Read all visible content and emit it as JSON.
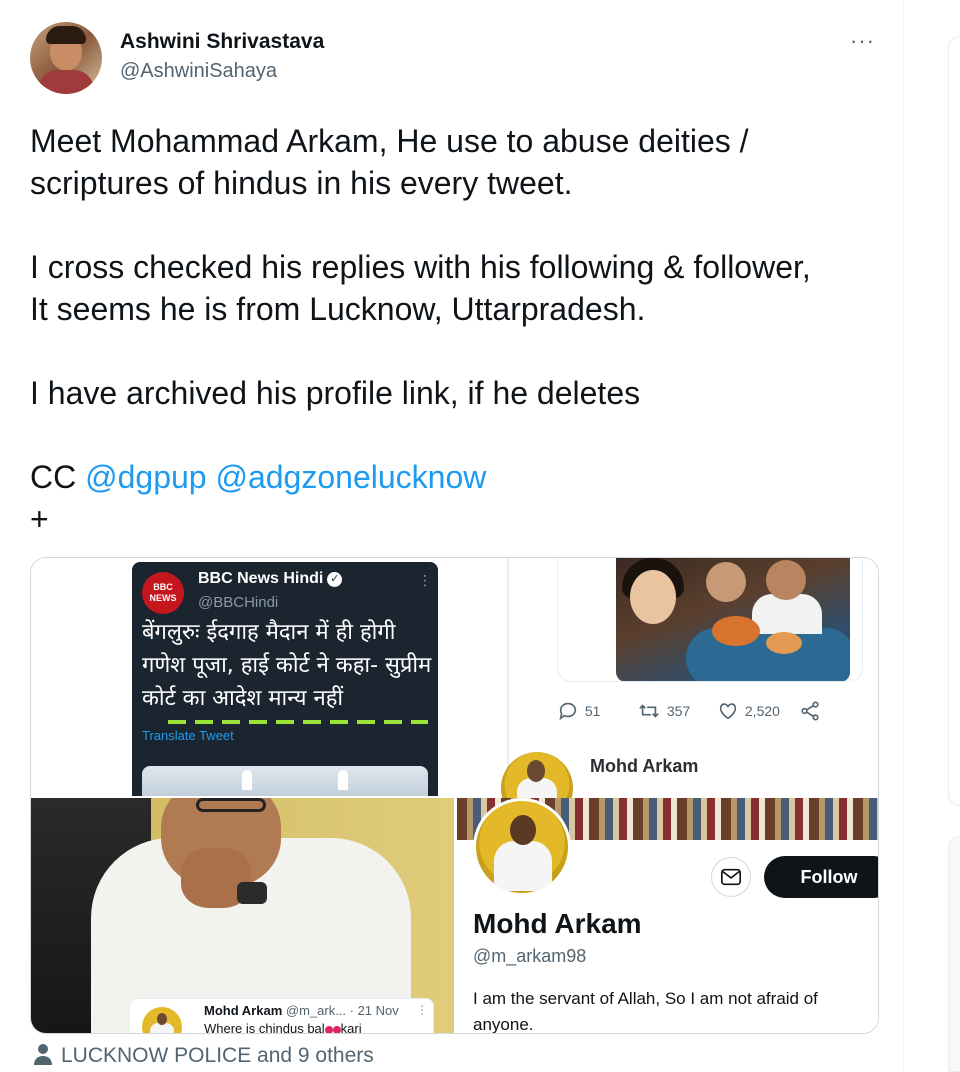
{
  "author": {
    "name": "Ashwini Shrivastava",
    "handle": "@AshwiniSahaya",
    "more_label": "···"
  },
  "tweet": {
    "lines": [
      "Meet Mohammad Arkam, He use to abuse deities /",
      "scriptures of hindus in his every tweet.",
      "I cross checked his replies with his following & follower,",
      "It seems he is from Lucknow, Uttarpradesh.",
      "I have archived his profile link,  if he deletes"
    ],
    "cc_prefix": "CC ",
    "mentions": [
      "@dgpup",
      "@adgzonelucknow"
    ],
    "plus": "+"
  },
  "media": {
    "bbc": {
      "logo_line1": "BBC",
      "logo_line2": "NEWS",
      "name": "BBC News Hindi",
      "handle": "@BBCHindi",
      "headline": "बेंगलुरुः ईदगाह मैदान में ही होगी गणेश पूजा, हाई कोर्ट ने कहा- सुप्रीम कोर्ट का आदेश मान्य नहीं",
      "translate": "Translate Tweet"
    },
    "stats": {
      "replies": "51",
      "retweets": "357",
      "likes": "2,520"
    },
    "mini_profile": {
      "name": "Mohd Arkam"
    },
    "embedded_reply": {
      "name": "Mohd Arkam",
      "handle_time": "@m_ark... · 21 Nov",
      "text_before": "Where is chindus bal",
      "text_after": "kari"
    },
    "profile": {
      "follow_label": "Follow",
      "name": "Mohd Arkam",
      "handle": "@m_arkam98",
      "bio": "I am the servant of Allah, So I am not afraid of anyone."
    }
  },
  "liked_by": "LUCKNOW POLICE and 9 others",
  "colors": {
    "accent": "#1d9bf0",
    "text": "#0f1419",
    "muted": "#536471"
  }
}
